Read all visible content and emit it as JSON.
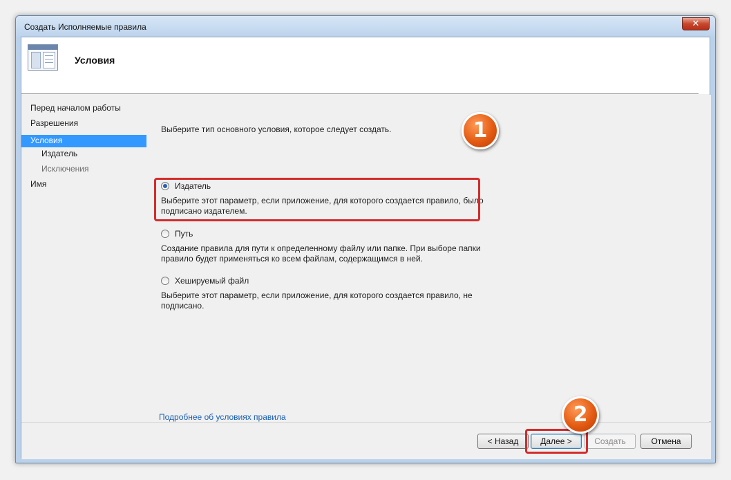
{
  "window": {
    "title": "Создать Исполняемые правила",
    "close_glyph": "✕"
  },
  "header": {
    "title": "Условия"
  },
  "nav": {
    "items": [
      {
        "label": "Перед началом работы"
      },
      {
        "label": "Разрешения"
      },
      {
        "label": "Условия",
        "selected": true
      },
      {
        "label": "Издатель"
      },
      {
        "label": "Исключения"
      },
      {
        "label": "Имя"
      }
    ]
  },
  "content": {
    "intro": "Выберите тип основного условия, которое следует создать.",
    "options": [
      {
        "label": "Издатель",
        "checked": true,
        "description": "Выберите этот параметр, если приложение, для которого создается правило, было подписано издателем."
      },
      {
        "label": "Путь",
        "checked": false,
        "description": "Создание правила для пути к определенному файлу или папке. При выборе папки правило будет применяться ко всем файлам, содержащимся в ней."
      },
      {
        "label": "Хешируемый файл",
        "checked": false,
        "description": "Выберите этот параметр, если приложение, для которого создается правило, не подписано."
      }
    ],
    "more_link": "Подробнее об условиях правила"
  },
  "footer": {
    "back": "< Назад",
    "next": "Далее >",
    "create": "Создать",
    "cancel": "Отмена"
  },
  "annotations": {
    "badge1": "1",
    "badge2": "2",
    "highlight_color": "#d42b2b",
    "badge_color": "#e45c13"
  }
}
